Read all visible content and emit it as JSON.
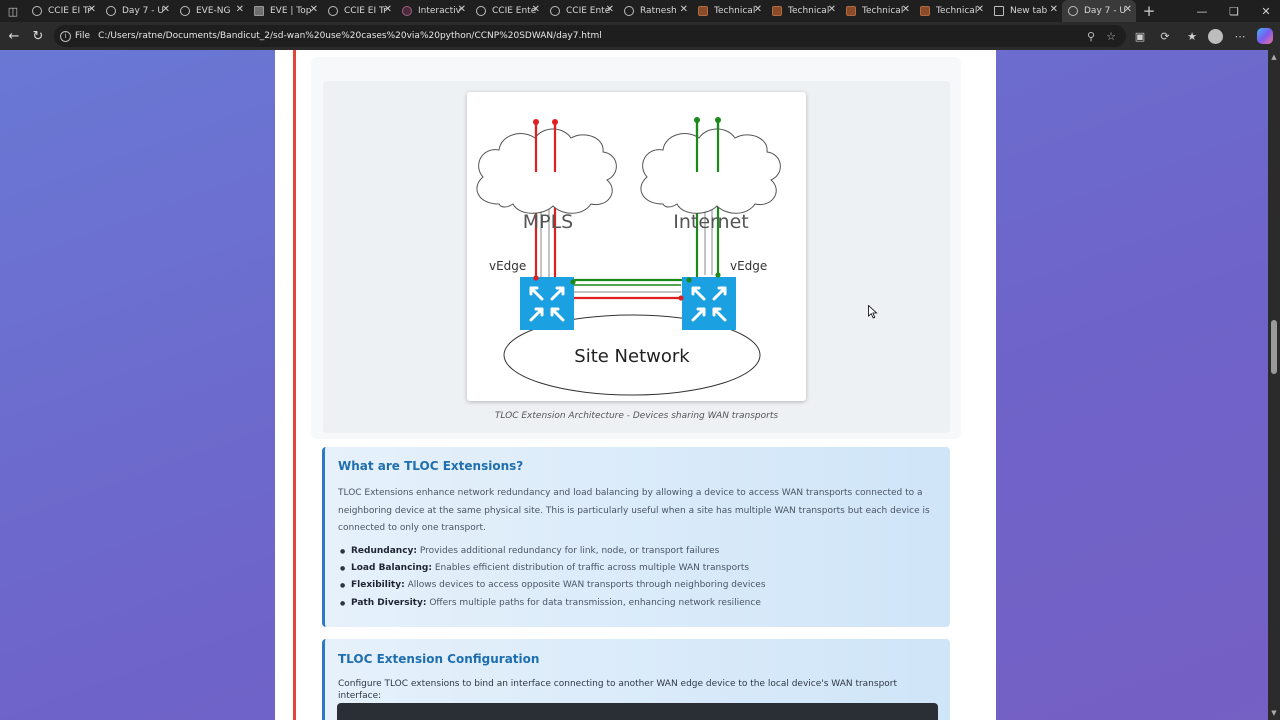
{
  "browser": {
    "tabs": [
      {
        "title": "CCIE EI Tr",
        "icon": "globe-icon",
        "active": false
      },
      {
        "title": "Day 7 - U",
        "icon": "globe-icon",
        "active": false
      },
      {
        "title": "EVE-NG",
        "icon": "globe-icon",
        "active": false
      },
      {
        "title": "EVE | Top",
        "icon": "image-icon",
        "active": false
      },
      {
        "title": "CCIE EI Tr",
        "icon": "globe-icon",
        "active": false
      },
      {
        "title": "Interactiv",
        "icon": "eve-icon",
        "active": false
      },
      {
        "title": "CCIE Ente",
        "icon": "globe-icon",
        "active": false
      },
      {
        "title": "CCIE Ente",
        "icon": "globe-icon",
        "active": false
      },
      {
        "title": "Ratnesh",
        "icon": "globe-icon",
        "active": false
      },
      {
        "title": "Technical",
        "icon": "doc-icon",
        "active": false
      },
      {
        "title": "Technical",
        "icon": "doc-icon",
        "active": false
      },
      {
        "title": "Technical",
        "icon": "doc-icon",
        "active": false
      },
      {
        "title": "Technical",
        "icon": "doc-icon",
        "active": false
      },
      {
        "title": "New tab",
        "icon": "newtab-icon",
        "active": false
      },
      {
        "title": "Day 7 - U",
        "icon": "globe-icon",
        "active": true
      }
    ],
    "address": {
      "scheme_label": "File",
      "url": "C:/Users/ratne/Documents/Bandicut_2/sd-wan%20use%20cases%20via%20python/CCNP%20SDWAN/day7.html"
    }
  },
  "diagram": {
    "cloud_left_label": "MPLS",
    "cloud_right_label": "Internet",
    "router_left_label": "vEdge",
    "router_right_label": "vEdge",
    "site_label": "Site Network",
    "colors": {
      "mpls_link": "#e02020",
      "internet_link": "#1a8a1a",
      "router": "#1ba1e2"
    }
  },
  "caption": "TLOC Extension Architecture - Devices sharing WAN transports",
  "section1": {
    "heading": "What are TLOC Extensions?",
    "paragraph": "TLOC Extensions enhance network redundancy and load balancing by allowing a device to access WAN transports connected to a neighboring device at the same physical site. This is particularly useful when a site has multiple WAN transports but each device is connected to only one transport.",
    "bullets": [
      {
        "term": "Redundancy:",
        "text": "Provides additional redundancy for link, node, or transport failures"
      },
      {
        "term": "Load Balancing:",
        "text": "Enables efficient distribution of traffic across multiple WAN transports"
      },
      {
        "term": "Flexibility:",
        "text": "Allows devices to access opposite WAN transports through neighboring devices"
      },
      {
        "term": "Path Diversity:",
        "text": "Offers multiple paths for data transmission, enhancing network resilience"
      }
    ]
  },
  "section2": {
    "heading": "TLOC Extension Configuration",
    "paragraph": "Configure TLOC extensions to bind an interface connecting to another WAN edge device to the local device's WAN transport interface:"
  }
}
